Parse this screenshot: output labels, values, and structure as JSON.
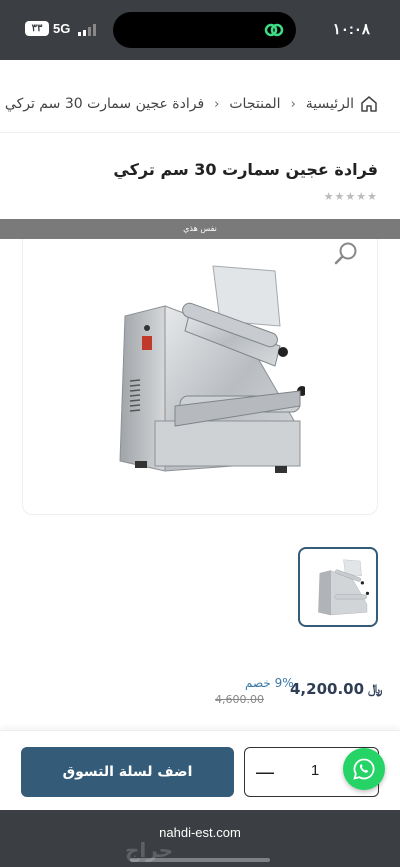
{
  "status_bar": {
    "time": "١٠:٠٨",
    "network": "5G",
    "battery": "٣٣"
  },
  "breadcrumb": {
    "home": "الرئيسية",
    "products": "المنتجات",
    "current": "فرادة عجين سمارت 30 سم تركي"
  },
  "product": {
    "title": "فرادة عجين سمارت 30 سم تركي",
    "rating_stars": "★★★★★",
    "banner_text": "نفس هذي",
    "price": "4,200.00",
    "old_price": "4,600.00",
    "discount": "9% خصم",
    "currency_symbol": "﷼"
  },
  "actions": {
    "add_to_cart": "اضف لسلة التسوق",
    "quantity": "1",
    "minus": "—"
  },
  "browser": {
    "url": "nahdi-est.com",
    "watermark": "حراج"
  },
  "icons": {
    "home": "home-icon",
    "zoom": "magnifier-icon",
    "whatsapp": "whatsapp-icon"
  },
  "colors": {
    "primary": "#345b78",
    "whatsapp": "#25d366",
    "status_bar": "#3b3e42"
  }
}
